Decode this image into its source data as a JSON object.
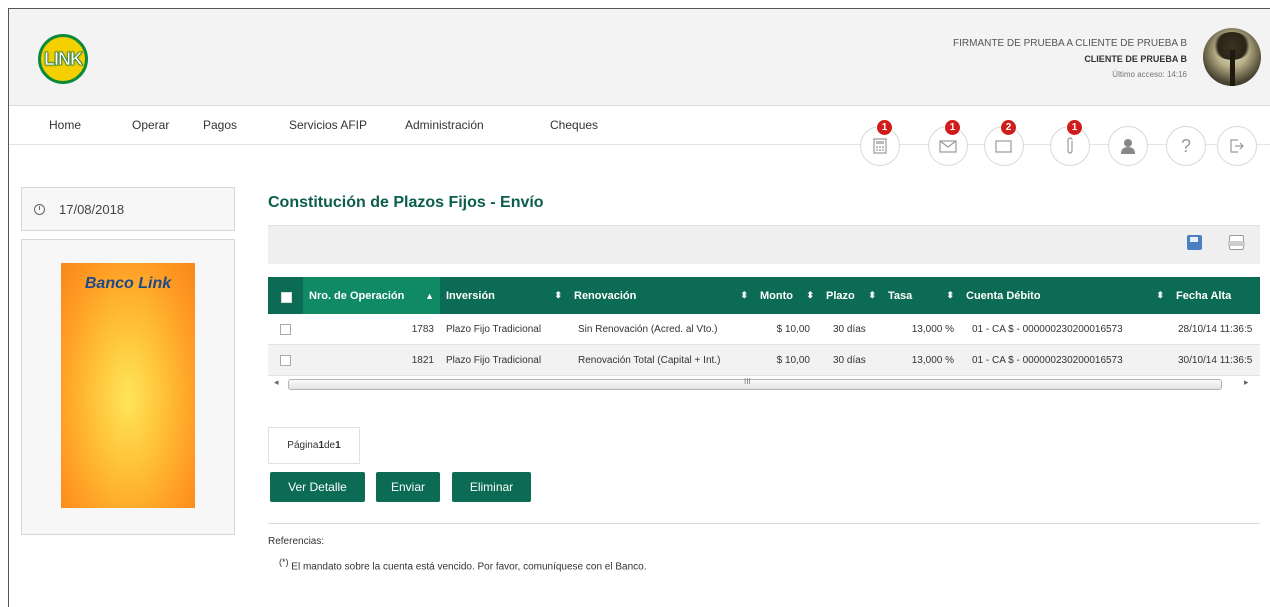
{
  "header": {
    "logo_text": "LINK",
    "user_firmante": "FIRMANTE DE PRUEBA A CLIENTE DE PRUEBA B",
    "user_cliente": "CLIENTE DE PRUEBA B",
    "last_access": "Último acceso: 14:16"
  },
  "nav": {
    "items": [
      "Home",
      "Operar",
      "Pagos",
      "Servicios AFIP",
      "Administración",
      "Cheques"
    ],
    "icons": [
      {
        "name": "calculator-icon",
        "badge": "1"
      },
      {
        "name": "mail-icon",
        "badge": "1"
      },
      {
        "name": "message-icon",
        "badge": "2"
      },
      {
        "name": "attachment-icon",
        "badge": "1"
      },
      {
        "name": "user-icon",
        "badge": ""
      },
      {
        "name": "help-icon",
        "badge": ""
      },
      {
        "name": "logout-icon",
        "badge": ""
      }
    ]
  },
  "sidebar": {
    "date": "17/08/2018",
    "promo_title": "Banco Link"
  },
  "main": {
    "title": "Constitución de Plazos Fijos - Envío",
    "columns": [
      "Nro. de Operación",
      "Inversión",
      "Renovación",
      "Monto",
      "Plazo",
      "Tasa",
      "Cuenta Débito",
      "Fecha Alta"
    ],
    "rows": [
      {
        "nro": "1783",
        "inversion": "Plazo Fijo Tradicional",
        "renovacion": "Sin Renovación (Acred. al Vto.)",
        "monto": "$ 10,00",
        "plazo": "30 días",
        "tasa": "13,000 %",
        "cuenta": "01 - CA $ - 000000230200016573",
        "fecha": "28/10/14 11:36:5"
      },
      {
        "nro": "1821",
        "inversion": "Plazo Fijo Tradicional",
        "renovacion": "Renovación Total (Capital + Int.)",
        "monto": "$ 10,00",
        "plazo": "30 días",
        "tasa": "13,000 %",
        "cuenta": "01 - CA $ - 000000230200016573",
        "fecha": "30/10/14 11:36:5"
      }
    ],
    "pager": {
      "prefix": "Página ",
      "current": "1",
      "middle": " de ",
      "total": "1"
    },
    "buttons": {
      "detalle": "Ver Detalle",
      "enviar": "Enviar",
      "eliminar": "Eliminar"
    },
    "references_title": "Referencias:",
    "reference_mark": "(*)",
    "reference_text": " El mandato sobre la cuenta está vencido. Por favor, comuníquese con el Banco."
  }
}
